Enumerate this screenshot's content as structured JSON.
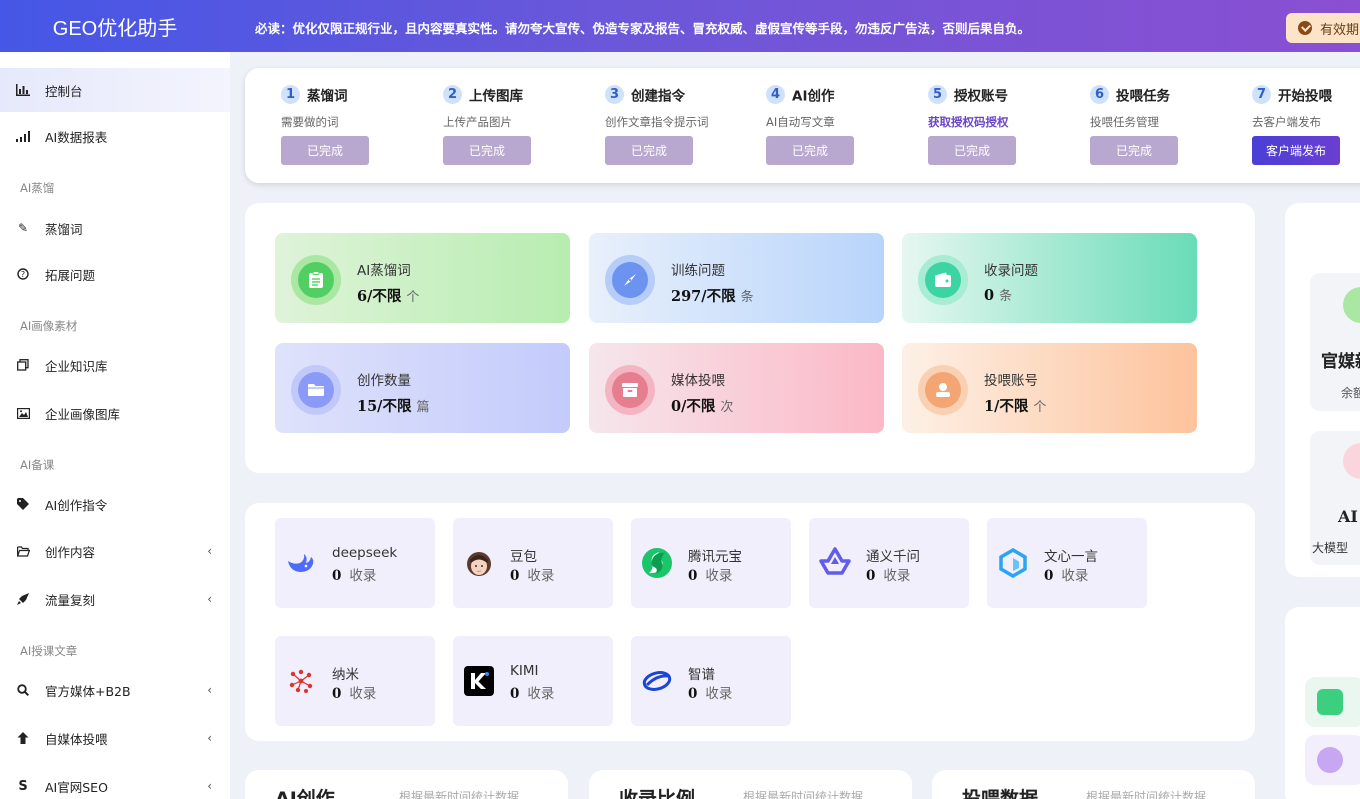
{
  "header": {
    "logo": "GEO优化助手",
    "notice": "必读：优化仅限正规行业，且内容要真实性。请勿夸大宣传、伪造专家及报告、冒充权威、虚假宣传等手段，勿违反广告法，否则后果自负。",
    "validity_label": "有效期"
  },
  "sidebar": {
    "items": [
      {
        "label": "控制台",
        "icon": "bar-chart-icon"
      },
      {
        "label": "AI数据报表",
        "icon": "signal-icon"
      },
      {
        "label": "蒸馏词",
        "icon": "tag-icon"
      },
      {
        "label": "拓展问题",
        "icon": "question-circle-icon"
      },
      {
        "label": "企业知识库",
        "icon": "copy-icon"
      },
      {
        "label": "企业画像图库",
        "icon": "image-icon"
      },
      {
        "label": "AI创作指令",
        "icon": "tag-fill-icon"
      },
      {
        "label": "创作内容",
        "icon": "folder-open-icon"
      },
      {
        "label": "流量复刻",
        "icon": "rocket-icon"
      },
      {
        "label": "官方媒体+B2B",
        "icon": "search-icon"
      },
      {
        "label": "自媒体投喂",
        "icon": "arrow-up-icon"
      },
      {
        "label": "AI官网SEO",
        "icon": "dollar-s-icon"
      }
    ],
    "groups": [
      "AI蒸馏",
      "AI画像素材",
      "AI备课",
      "AI授课文章"
    ]
  },
  "steps": [
    {
      "num": "1",
      "title": "蒸馏词",
      "desc": "需要做的词",
      "button": "已完成"
    },
    {
      "num": "2",
      "title": "上传图库",
      "desc": "上传产品图片",
      "button": "已完成"
    },
    {
      "num": "3",
      "title": "创建指令",
      "desc": "创作文章指令提示词",
      "button": "已完成"
    },
    {
      "num": "4",
      "title": "AI创作",
      "desc": "AI自动写文章",
      "button": "已完成"
    },
    {
      "num": "5",
      "title": "授权账号",
      "desc": "获取授权码授权",
      "button": "已完成"
    },
    {
      "num": "6",
      "title": "投喂任务",
      "desc": "投喂任务管理",
      "button": "已完成"
    },
    {
      "num": "7",
      "title": "开始投喂",
      "desc": "去客户端发布",
      "button": "客户端发布"
    }
  ],
  "stats": [
    {
      "label": "AI蒸馏词",
      "value": "6/不限",
      "unit": "个",
      "icon": "clipboard-icon"
    },
    {
      "label": "训练问题",
      "value": "297/不限",
      "unit": "条",
      "icon": "compass-icon"
    },
    {
      "label": "收录问题",
      "value": "0",
      "unit": "条",
      "icon": "wallet-icon"
    },
    {
      "label": "创作数量",
      "value": "15/不限",
      "unit": "篇",
      "icon": "folder-icon"
    },
    {
      "label": "媒体投喂",
      "value": "0/不限",
      "unit": "次",
      "icon": "archive-icon"
    },
    {
      "label": "投喂账号",
      "value": "1/不限",
      "unit": "个",
      "icon": "user-icon"
    }
  ],
  "platforms": [
    {
      "name": "deepseek",
      "value": "0",
      "unit": "收录",
      "icon": "deepseek-whale-icon"
    },
    {
      "name": "豆包",
      "value": "0",
      "unit": "收录",
      "icon": "doubao-avatar-icon"
    },
    {
      "name": "腾讯元宝",
      "value": "0",
      "unit": "收录",
      "icon": "yuanbao-icon"
    },
    {
      "name": "通义千问",
      "value": "0",
      "unit": "收录",
      "icon": "tongyi-icon"
    },
    {
      "name": "文心一言",
      "value": "0",
      "unit": "收录",
      "icon": "wenxin-icon"
    },
    {
      "name": "纳米",
      "value": "0",
      "unit": "收录",
      "icon": "nami-icon"
    },
    {
      "name": "KIMI",
      "value": "0",
      "unit": "收录",
      "icon": "kimi-icon"
    },
    {
      "name": "智谱",
      "value": "0",
      "unit": "收录",
      "icon": "zhipu-icon"
    }
  ],
  "bottom_cards": [
    {
      "title": "AI创作",
      "subtitle": "根据最新时间统计数据"
    },
    {
      "title": "收录比例",
      "subtitle": "根据最新时间统计数据"
    },
    {
      "title": "投喂数据",
      "subtitle": "根据最新时间统计数据"
    }
  ],
  "right_panel": {
    "box1_title": "官媒新",
    "box1_sub": "余额",
    "box2_title": "AI",
    "box2_sub": "大模型"
  }
}
